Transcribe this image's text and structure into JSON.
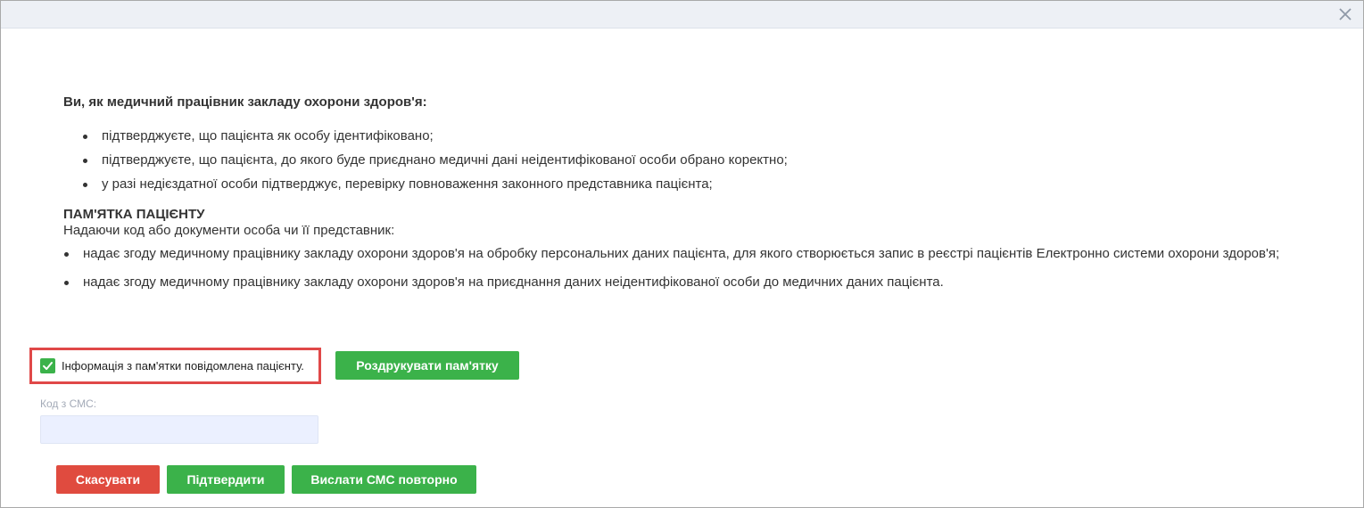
{
  "colors": {
    "header_bg": "#edf0f5",
    "green": "#3bb24a",
    "red": "#e04b3f",
    "highlight_border": "#e04848",
    "input_bg": "#ebf0ff"
  },
  "header": {
    "close_icon": "close-icon"
  },
  "intro": {
    "lead": "Ви, як медичний працівник закладу охорони здоров'я:",
    "items": [
      "підтверджуєте, що пацієнта як особу ідентифіковано;",
      "підтверджуєте, що пацієнта, до якого буде приєднано медичні дані неідентифікованої особи обрано коректно;",
      "у разі недієздатної особи підтверджує, перевірку повноваження законного представника пацієнта;"
    ]
  },
  "memo": {
    "title": "ПАМ'ЯТКА ПАЦІЄНТУ",
    "intro": "Надаючи код або документи особа чи її представник:",
    "items": [
      "надає згоду медичному працівнику закладу охорони здоров'я на обробку персональних даних пацієнта, для якого створюється запис в реєстрі пацієнтів Електронно системи охорони здоров'я;",
      "надає згоду медичному працівнику закладу охорони здоров'я на приєднання даних неідентифікованої особи до медичних даних пацієнта."
    ]
  },
  "confirm_checkbox": {
    "label": "Інформація з пам'ятки повідомлена пацієнту.",
    "checked": true
  },
  "print_button": "Роздрукувати пам'ятку",
  "sms": {
    "label": "Код з СМС:",
    "value": "",
    "placeholder": ""
  },
  "actions": {
    "cancel": "Скасувати",
    "confirm": "Підтвердити",
    "resend": "Вислати СМС повторно"
  }
}
